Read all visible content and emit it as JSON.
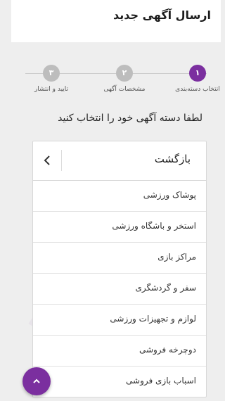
{
  "header": {
    "title": "ارسال آگهی جدید"
  },
  "stepper": {
    "steps": [
      {
        "number": "۱",
        "label": "انتخاب دسته‌بندی",
        "state": "active"
      },
      {
        "number": "۲",
        "label": "مشخصات آگهی",
        "state": "inactive"
      },
      {
        "number": "۳",
        "label": "تایید و انتشار",
        "state": "inactive"
      }
    ]
  },
  "main": {
    "prompt": "لطفا دسته آگهی خود را انتخاب کنید",
    "back_label": "بازگشت",
    "categories": [
      "پوشاک ورزشی",
      "استخر و باشگاه ورزشی",
      "مراکز بازی",
      "سفر و گردشگری",
      "لوازم و تجهیزات ورزشی",
      "دوچرخه فروشی",
      "اسباب بازی فروشی"
    ]
  },
  "colors": {
    "accent": "#7b2f9f",
    "inactive_step": "#bdbdbd"
  },
  "fab": {
    "icon": "chevron-up-icon"
  }
}
